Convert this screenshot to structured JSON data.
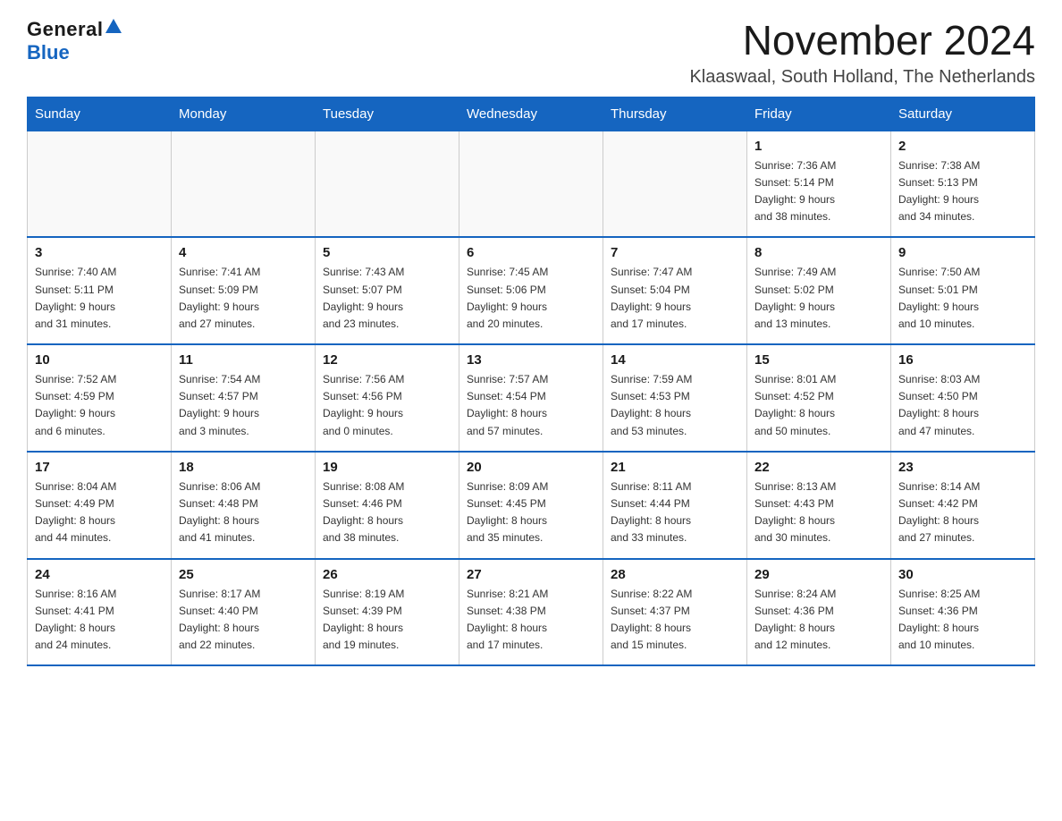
{
  "header": {
    "logo_general": "General",
    "logo_blue": "Blue",
    "month_title": "November 2024",
    "location": "Klaaswaal, South Holland, The Netherlands"
  },
  "calendar": {
    "days_of_week": [
      "Sunday",
      "Monday",
      "Tuesday",
      "Wednesday",
      "Thursday",
      "Friday",
      "Saturday"
    ],
    "weeks": [
      [
        {
          "day": "",
          "info": ""
        },
        {
          "day": "",
          "info": ""
        },
        {
          "day": "",
          "info": ""
        },
        {
          "day": "",
          "info": ""
        },
        {
          "day": "",
          "info": ""
        },
        {
          "day": "1",
          "info": "Sunrise: 7:36 AM\nSunset: 5:14 PM\nDaylight: 9 hours\nand 38 minutes."
        },
        {
          "day": "2",
          "info": "Sunrise: 7:38 AM\nSunset: 5:13 PM\nDaylight: 9 hours\nand 34 minutes."
        }
      ],
      [
        {
          "day": "3",
          "info": "Sunrise: 7:40 AM\nSunset: 5:11 PM\nDaylight: 9 hours\nand 31 minutes."
        },
        {
          "day": "4",
          "info": "Sunrise: 7:41 AM\nSunset: 5:09 PM\nDaylight: 9 hours\nand 27 minutes."
        },
        {
          "day": "5",
          "info": "Sunrise: 7:43 AM\nSunset: 5:07 PM\nDaylight: 9 hours\nand 23 minutes."
        },
        {
          "day": "6",
          "info": "Sunrise: 7:45 AM\nSunset: 5:06 PM\nDaylight: 9 hours\nand 20 minutes."
        },
        {
          "day": "7",
          "info": "Sunrise: 7:47 AM\nSunset: 5:04 PM\nDaylight: 9 hours\nand 17 minutes."
        },
        {
          "day": "8",
          "info": "Sunrise: 7:49 AM\nSunset: 5:02 PM\nDaylight: 9 hours\nand 13 minutes."
        },
        {
          "day": "9",
          "info": "Sunrise: 7:50 AM\nSunset: 5:01 PM\nDaylight: 9 hours\nand 10 minutes."
        }
      ],
      [
        {
          "day": "10",
          "info": "Sunrise: 7:52 AM\nSunset: 4:59 PM\nDaylight: 9 hours\nand 6 minutes."
        },
        {
          "day": "11",
          "info": "Sunrise: 7:54 AM\nSunset: 4:57 PM\nDaylight: 9 hours\nand 3 minutes."
        },
        {
          "day": "12",
          "info": "Sunrise: 7:56 AM\nSunset: 4:56 PM\nDaylight: 9 hours\nand 0 minutes."
        },
        {
          "day": "13",
          "info": "Sunrise: 7:57 AM\nSunset: 4:54 PM\nDaylight: 8 hours\nand 57 minutes."
        },
        {
          "day": "14",
          "info": "Sunrise: 7:59 AM\nSunset: 4:53 PM\nDaylight: 8 hours\nand 53 minutes."
        },
        {
          "day": "15",
          "info": "Sunrise: 8:01 AM\nSunset: 4:52 PM\nDaylight: 8 hours\nand 50 minutes."
        },
        {
          "day": "16",
          "info": "Sunrise: 8:03 AM\nSunset: 4:50 PM\nDaylight: 8 hours\nand 47 minutes."
        }
      ],
      [
        {
          "day": "17",
          "info": "Sunrise: 8:04 AM\nSunset: 4:49 PM\nDaylight: 8 hours\nand 44 minutes."
        },
        {
          "day": "18",
          "info": "Sunrise: 8:06 AM\nSunset: 4:48 PM\nDaylight: 8 hours\nand 41 minutes."
        },
        {
          "day": "19",
          "info": "Sunrise: 8:08 AM\nSunset: 4:46 PM\nDaylight: 8 hours\nand 38 minutes."
        },
        {
          "day": "20",
          "info": "Sunrise: 8:09 AM\nSunset: 4:45 PM\nDaylight: 8 hours\nand 35 minutes."
        },
        {
          "day": "21",
          "info": "Sunrise: 8:11 AM\nSunset: 4:44 PM\nDaylight: 8 hours\nand 33 minutes."
        },
        {
          "day": "22",
          "info": "Sunrise: 8:13 AM\nSunset: 4:43 PM\nDaylight: 8 hours\nand 30 minutes."
        },
        {
          "day": "23",
          "info": "Sunrise: 8:14 AM\nSunset: 4:42 PM\nDaylight: 8 hours\nand 27 minutes."
        }
      ],
      [
        {
          "day": "24",
          "info": "Sunrise: 8:16 AM\nSunset: 4:41 PM\nDaylight: 8 hours\nand 24 minutes."
        },
        {
          "day": "25",
          "info": "Sunrise: 8:17 AM\nSunset: 4:40 PM\nDaylight: 8 hours\nand 22 minutes."
        },
        {
          "day": "26",
          "info": "Sunrise: 8:19 AM\nSunset: 4:39 PM\nDaylight: 8 hours\nand 19 minutes."
        },
        {
          "day": "27",
          "info": "Sunrise: 8:21 AM\nSunset: 4:38 PM\nDaylight: 8 hours\nand 17 minutes."
        },
        {
          "day": "28",
          "info": "Sunrise: 8:22 AM\nSunset: 4:37 PM\nDaylight: 8 hours\nand 15 minutes."
        },
        {
          "day": "29",
          "info": "Sunrise: 8:24 AM\nSunset: 4:36 PM\nDaylight: 8 hours\nand 12 minutes."
        },
        {
          "day": "30",
          "info": "Sunrise: 8:25 AM\nSunset: 4:36 PM\nDaylight: 8 hours\nand 10 minutes."
        }
      ]
    ]
  }
}
